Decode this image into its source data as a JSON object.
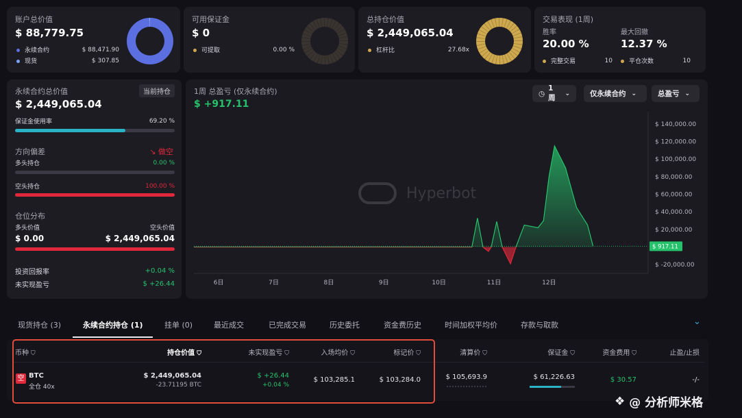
{
  "summary": {
    "account": {
      "title": "账户总价值",
      "value": "$ 88,779.75",
      "items": [
        {
          "label": "永续合约",
          "value": "$ 88,471.90"
        },
        {
          "label": "现货",
          "value": "$ 307.85"
        }
      ]
    },
    "margin": {
      "title": "可用保证金",
      "value": "$ 0",
      "items": [
        {
          "label": "可提取",
          "value": "0.00 %"
        }
      ]
    },
    "positions": {
      "title": "总持仓价值",
      "value": "$ 2,449,065.04",
      "items": [
        {
          "label": "杠杆比",
          "value": "27.68x"
        }
      ]
    },
    "performance": {
      "title": "交易表现 (1周)",
      "win_label": "胜率",
      "win_value": "20.00 %",
      "dd_label": "最大回撤",
      "dd_value": "12.37 %",
      "trades_label": "完整交易",
      "trades_value": "10",
      "close_label": "平仓次数",
      "close_value": "10"
    }
  },
  "perp": {
    "title": "永续合约总价值",
    "badge": "当前持仓",
    "value": "$ 2,449,065.04",
    "usage_label": "保证金使用率",
    "usage_value": "69.20 %",
    "usage_fraction": 0.692,
    "bias_label": "方向偏差",
    "bias_value": "做空",
    "long_label": "多头持仓",
    "long_value": "0.00 %",
    "long_fraction": 0.0,
    "short_label": "空头持仓",
    "short_value": "100.00 %",
    "short_fraction": 1.0,
    "dist_title": "仓位分布",
    "long_val_label": "多头价值",
    "long_val": "$ 0.00",
    "short_val_label": "空头价值",
    "short_val": "$ 2,449,065.04",
    "roi_label": "投资回报率",
    "roi_value": "+0.04 %",
    "upnl_label": "未实现盈亏",
    "upnl_value": "$ +26.44"
  },
  "pnl_chart": {
    "title": "1周 总盈亏 (仅永续合约)",
    "value": "$ +917.11",
    "controls": {
      "period": "1周",
      "scope": "仅永续合约",
      "metric": "总盈亏"
    },
    "watermark": "Hyperbot",
    "current_label": "$ 917.11"
  },
  "chart_data": {
    "type": "area",
    "title": "1周 总盈亏 (仅永续合约)",
    "x_ticks": [
      "6日",
      "7日",
      "8日",
      "9日",
      "10日",
      "11日",
      "12日"
    ],
    "y_ticks": [
      "$ 140,000.00",
      "$ 120,000.00",
      "$ 100,000.00",
      "$ 80,000.00",
      "$ 60,000.00",
      "$ 40,000.00",
      "$ 20,000.00",
      "$ -20,000.00"
    ],
    "ylim": [
      -30000,
      150000
    ],
    "xlim": [
      5.55,
      13.8
    ],
    "series": [
      {
        "x": [
          5.55,
          6,
          7,
          8,
          9,
          9.8,
          10.25,
          10.45,
          10.6,
          10.7,
          10.8,
          10.9,
          10.95,
          11.05,
          11.15,
          11.3,
          11.4,
          11.55,
          11.8,
          11.9,
          12,
          12.1,
          12.3,
          12.5,
          12.7,
          12.8
        ],
        "y": [
          0,
          0,
          0,
          0,
          0,
          0,
          0,
          0,
          0,
          33000,
          0,
          -5000,
          0,
          29000,
          0,
          -19000,
          0,
          25000,
          22000,
          30000,
          80000,
          115000,
          90000,
          45000,
          25000,
          917
        ]
      }
    ]
  },
  "tabs": [
    "现货持仓 (3)",
    "永续合约持仓 (1)",
    "挂单 (0)",
    "最近成交",
    "已完成交易",
    "历史委托",
    "资金费历史",
    "时间加权平均价",
    "存款与取款"
  ],
  "table": {
    "headers": [
      "币种",
      "持仓价值",
      "未实现盈亏",
      "入场均价",
      "标记价",
      "清算价",
      "保证金",
      "资金费用",
      "止盈/止损"
    ],
    "row": {
      "side_icon": "空",
      "coin": "BTC",
      "mode": "全仓 40x",
      "value": "$ 2,449,065.04",
      "size": "-23.71195 BTC",
      "upnl": "$ +26.44",
      "upnl_pct": "+0.04 %",
      "entry": "$ 103,285.1",
      "mark": "$ 103,284.0",
      "liq": "$ 105,693.9",
      "margin": "$ 61,226.63",
      "funding": "$ 30.57",
      "tpsl": "-/-"
    }
  },
  "watermark_text": "@ 分析师米格",
  "colors": {
    "green": "#26c26b",
    "red": "#e0283a",
    "blue": "#5b6fe0",
    "gold": "#cfa94e",
    "teal": "#2ab3c4"
  }
}
